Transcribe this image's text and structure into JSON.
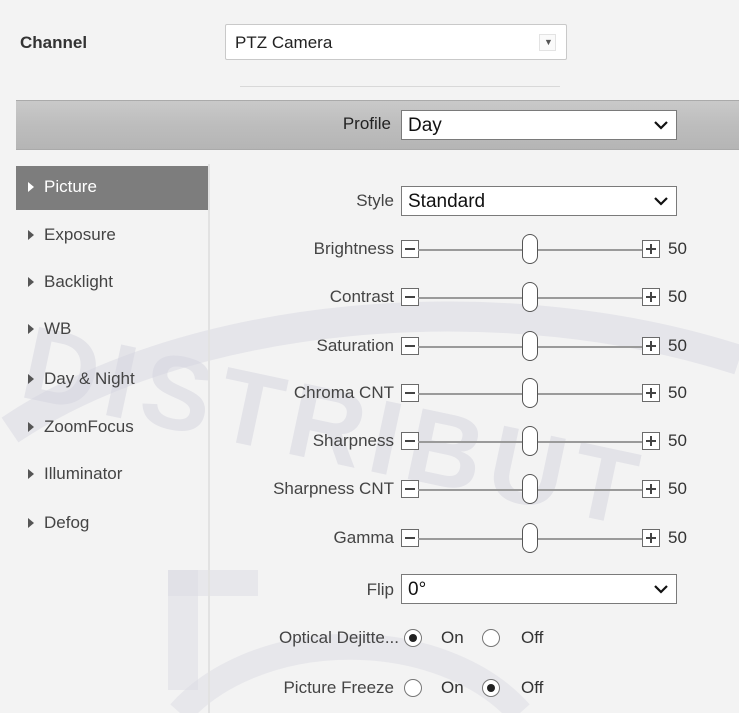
{
  "channel": {
    "label": "Channel",
    "value": "PTZ Camera"
  },
  "profile": {
    "label": "Profile",
    "value": "Day"
  },
  "menu": [
    {
      "label": "Picture",
      "active": true
    },
    {
      "label": "Exposure"
    },
    {
      "label": "Backlight"
    },
    {
      "label": "WB"
    },
    {
      "label": "Day & Night"
    },
    {
      "label": "ZoomFocus"
    },
    {
      "label": "Illuminator"
    },
    {
      "label": "Defog"
    }
  ],
  "style": {
    "label": "Style",
    "value": "Standard"
  },
  "sliders": [
    {
      "label": "Brightness",
      "value": "50",
      "level": 0.5
    },
    {
      "label": "Contrast",
      "value": "50",
      "level": 0.5
    },
    {
      "label": "Saturation",
      "value": "50",
      "level": 0.5
    },
    {
      "label": "Chroma CNT",
      "value": "50",
      "level": 0.5
    },
    {
      "label": "Sharpness",
      "value": "50",
      "level": 0.5
    },
    {
      "label": "Sharpness CNT",
      "value": "50",
      "level": 0.5
    },
    {
      "label": "Gamma",
      "value": "50",
      "level": 0.5
    }
  ],
  "flip": {
    "label": "Flip",
    "value": "0°"
  },
  "optical_dejitter": {
    "label": "Optical Dejitte...",
    "on": "On",
    "off": "Off",
    "selected": "on"
  },
  "picture_freeze": {
    "label": "Picture Freeze",
    "on": "On",
    "off": "Off",
    "selected": "off"
  },
  "watermark": {
    "text": "DISTRIBUT"
  },
  "colors": {
    "menu_active": "#7d7d7d",
    "background": "#f3f3f3",
    "profile_bar": "#c0c0c0"
  }
}
